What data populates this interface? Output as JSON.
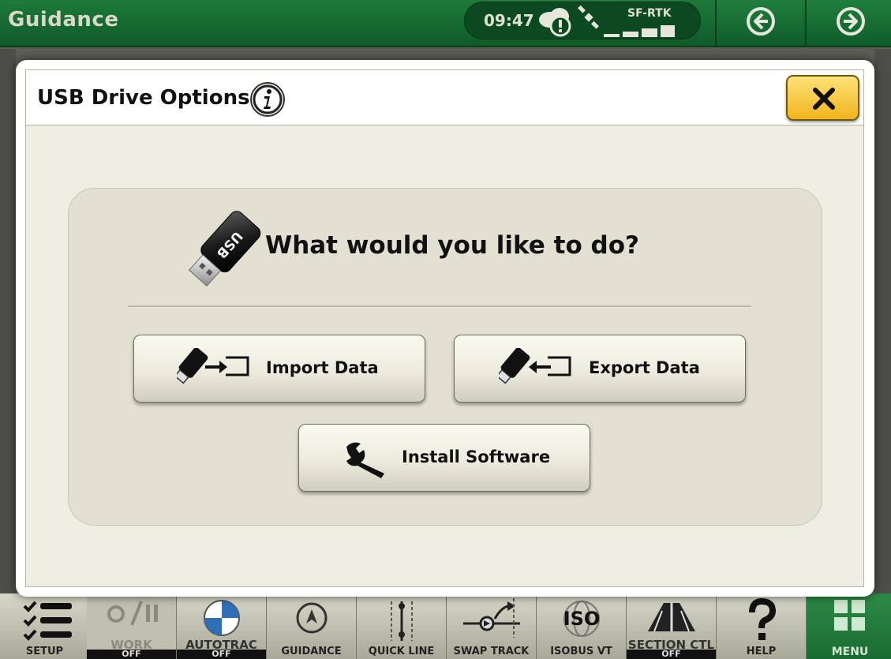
{
  "topbar": {
    "title": "Guidance",
    "time": "09:47",
    "signal_label": "SF-RTK",
    "back_icon": "arrow-left-circle-icon",
    "forward_icon": "arrow-right-circle-icon"
  },
  "modal": {
    "title": "USB Drive Options",
    "question": "What would you like to do?",
    "buttons": {
      "import": "Import Data",
      "export": "Export Data",
      "install": "Install Software"
    }
  },
  "dock": {
    "items": [
      {
        "label": "SETUP"
      },
      {
        "label": "WORK",
        "state": "OFF"
      },
      {
        "label": "AUTOTRAC",
        "state": "OFF"
      },
      {
        "label": "GUIDANCE"
      },
      {
        "label": "QUICK LINE"
      },
      {
        "label": "SWAP TRACK"
      },
      {
        "label": "ISOBUS VT"
      },
      {
        "label": "SECTION CTL",
        "state": "OFF"
      },
      {
        "label": "HELP"
      },
      {
        "label": "MENU"
      }
    ],
    "isobus_icon_text": "ISO"
  },
  "colors": {
    "topbar_green": "#1d7a3a",
    "close_yellow": "#f1b51c",
    "panel_bg": "#e2e0d1",
    "modal_bg": "#efeee2"
  }
}
